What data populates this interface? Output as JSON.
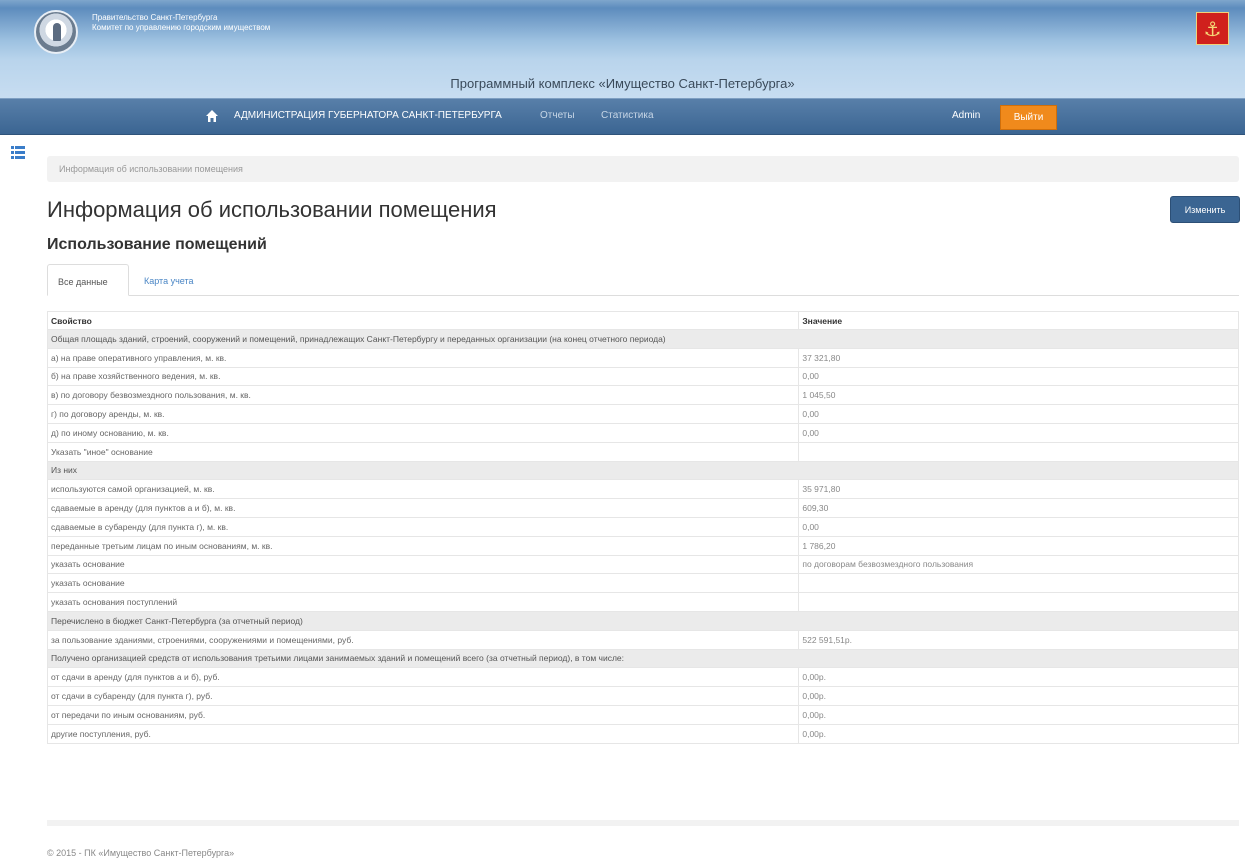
{
  "header": {
    "org_line1": "Правительство Санкт-Петербурга",
    "org_line2": "Комитет по управлению городским имуществом",
    "subtitle": "Программный комплекс «Имущество Санкт-Петербурга»"
  },
  "nav": {
    "home_icon": "home-icon",
    "items": [
      {
        "label": "АДМИНИСТРАЦИЯ ГУБЕРНАТОРА САНКТ-ПЕТЕРБУРГА"
      },
      {
        "label": "Отчеты"
      },
      {
        "label": "Статистика"
      }
    ],
    "user": "Admin",
    "logout_label": "Выйти"
  },
  "breadcrumb": "Информация об использовании помещения",
  "page_title": "Информация об использовании помещения",
  "edit_button": "Изменить",
  "section_title": "Использование помещений",
  "tabs": [
    {
      "label": "Все данные",
      "active": true
    },
    {
      "label": "Карта учета",
      "active": false
    }
  ],
  "table": {
    "headers": [
      "Свойство",
      "Значение"
    ],
    "rows": [
      {
        "group": true,
        "label": "Общая площадь зданий, строений, сооружений и помещений, принадлежащих Санкт-Петербургу и переданных организации (на конец отчетного периода)",
        "value": ""
      },
      {
        "group": false,
        "label": "а) на праве оперативного управления, м. кв.",
        "value": "37 321,80"
      },
      {
        "group": false,
        "label": "б) на праве хозяйственного ведения, м. кв.",
        "value": "0,00"
      },
      {
        "group": false,
        "label": "в) по договору безвозмездного пользования, м. кв.",
        "value": "1 045,50"
      },
      {
        "group": false,
        "label": "г) по договору аренды, м. кв.",
        "value": "0,00"
      },
      {
        "group": false,
        "label": "д) по иному основанию, м. кв.",
        "value": "0,00"
      },
      {
        "group": false,
        "label": "Указать \"иное\" основание",
        "value": ""
      },
      {
        "group": true,
        "label": "Из них",
        "value": ""
      },
      {
        "group": false,
        "label": "используются самой организацией, м. кв.",
        "value": "35 971,80"
      },
      {
        "group": false,
        "label": "сдаваемые в аренду (для пунктов а и б), м. кв.",
        "value": "609,30"
      },
      {
        "group": false,
        "label": "сдаваемые в субаренду (для пункта г), м. кв.",
        "value": "0,00"
      },
      {
        "group": false,
        "label": "переданные третьим лицам по иным основаниям, м. кв.",
        "value": "1 786,20"
      },
      {
        "group": false,
        "label": "указать основание",
        "value": "по договорам безвозмездного пользования"
      },
      {
        "group": false,
        "label": "указать основание",
        "value": ""
      },
      {
        "group": false,
        "label": "указать основания поступлений",
        "value": ""
      },
      {
        "group": true,
        "label": "Перечислено в бюджет Санкт-Петербурга (за отчетный период)",
        "value": ""
      },
      {
        "group": false,
        "label": "за пользование зданиями, строениями, сооружениями и помещениями, руб.",
        "value": "522 591,51р."
      },
      {
        "group": true,
        "label": "Получено организацией средств от использования третьими лицами занимаемых зданий и помещений всего (за отчетный период), в том числе:",
        "value": ""
      },
      {
        "group": false,
        "label": "от сдачи в аренду (для пунктов а и б), руб.",
        "value": "0,00р."
      },
      {
        "group": false,
        "label": "от сдачи в субаренду (для пункта г), руб.",
        "value": "0,00р."
      },
      {
        "group": false,
        "label": "от передачи по иным основаниям, руб.",
        "value": "0,00р."
      },
      {
        "group": false,
        "label": "другие поступления, руб.",
        "value": "0,00р."
      }
    ]
  },
  "footer": "© 2015 - ПК «Имущество Санкт-Петербурга»",
  "colors": {
    "navbar": "#3b6592",
    "logout": "#f08a1c",
    "group_row": "#ebebeb",
    "link": "#4a86c5"
  }
}
